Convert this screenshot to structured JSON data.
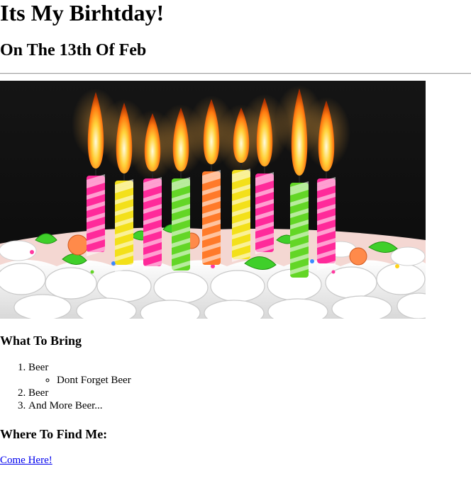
{
  "page": {
    "title": "Its My Birhtday!",
    "subtitle": "On The 13th Of Feb"
  },
  "image": {
    "icon": "birthday-cake-with-candles-photo",
    "candle_colors": [
      "#ff2a9a",
      "#f3e01a",
      "#ff2a9a",
      "#63d626",
      "#ff7a2a",
      "#f3e01a",
      "#ff2a9a",
      "#63d626",
      "#ff2a9a"
    ]
  },
  "bring_section": {
    "heading": "What To Bring",
    "items": [
      {
        "label": "Beer",
        "subitems": [
          "Dont Forget Beer"
        ]
      },
      {
        "label": "Beer"
      },
      {
        "label": "And More Beer..."
      }
    ]
  },
  "find_section": {
    "heading": "Where To Find Me:",
    "link_label": "Come Here!"
  },
  "colors": {
    "link": "#0000ee",
    "text": "#000000",
    "background": "#ffffff"
  }
}
